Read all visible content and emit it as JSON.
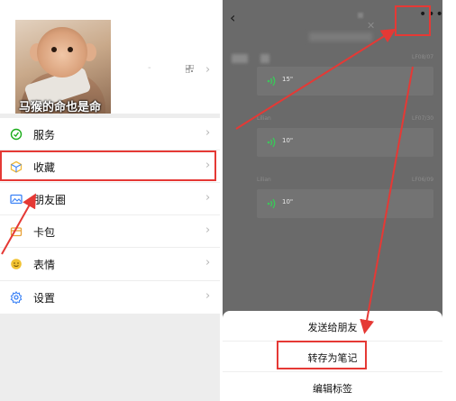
{
  "profile": {
    "caption": "马猴的命也是命",
    "dash": "-"
  },
  "menu": [
    {
      "label": "服务",
      "icon": "service-icon"
    },
    {
      "label": "收藏",
      "icon": "favorites-icon"
    },
    {
      "label": "朋友圈",
      "icon": "moments-icon"
    },
    {
      "label": "卡包",
      "icon": "cards-icon"
    },
    {
      "label": "表情",
      "icon": "sticker-icon"
    }
  ],
  "settings": {
    "label": "设置",
    "icon": "settings-icon"
  },
  "detail": {
    "notes": [
      {
        "meta": "",
        "time": "LF08/07",
        "duration": "15\""
      },
      {
        "meta": "Lilian",
        "time": "LF07/30",
        "duration": "10\""
      },
      {
        "meta": "Lilian",
        "time": "LF06/09",
        "duration": "10\""
      }
    ]
  },
  "sheet": {
    "send_to_friend": "发送给朋友",
    "save_as_note": "转存为笔记",
    "edit_tags": "编辑标签"
  },
  "colors": {
    "annotation": "#e53935",
    "voice_icon": "#3cc65a",
    "service_icon": "#1aad19",
    "favorites_icon": "#f0b93b",
    "moments_icon": "#3b82f6",
    "cards_icon": "#e8a23a",
    "sticker_icon": "#f1c232",
    "settings_icon": "#3b82f6"
  }
}
